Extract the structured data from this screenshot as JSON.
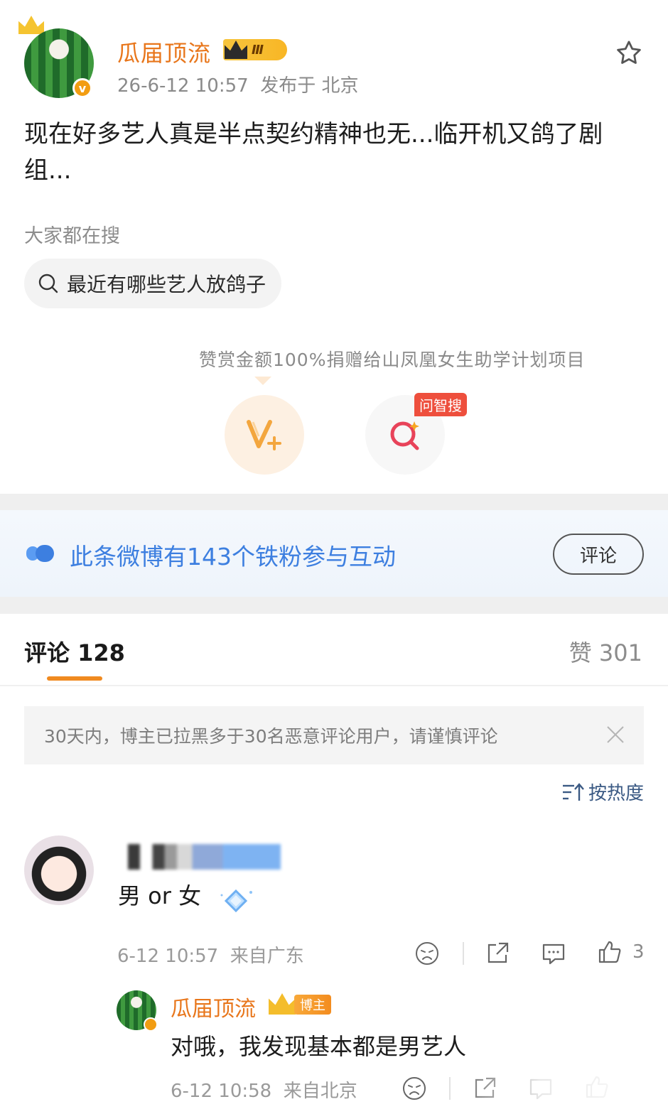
{
  "post": {
    "author": "瓜届顶流",
    "vip_level": "Ⅲ",
    "time": "26-6-12 10:57",
    "location": "发布于 北京",
    "body": "现在好多艺人真是半点契约精神也无...临开机又鸽了剧组..."
  },
  "search": {
    "label": "大家都在搜",
    "query": "最近有哪些艺人放鸽子"
  },
  "donate": {
    "text": "赞赏金额100%捐赠给山凤凰女生助学计划项目",
    "ask_tag": "问智搜"
  },
  "fans_banner": {
    "text": "此条微博有143个铁粉参与互动",
    "button": "评论"
  },
  "tabs": {
    "comments": "评论 128",
    "likes": "赞 301"
  },
  "notice": {
    "text": "30天内，博主已拉黑多于30名恶意评论用户，请谨慎评论"
  },
  "sort": {
    "label": "按热度"
  },
  "comments": [
    {
      "text": "男 or 女",
      "time": "6-12 10:57",
      "location": "来自广东",
      "likes": "3"
    }
  ],
  "reply": {
    "author": "瓜届顶流",
    "tag": "博主",
    "text": "对哦，我发现基本都是男艺人",
    "time": "6-12 10:58",
    "location": "来自北京"
  },
  "colors": {
    "brand_orange": "#e8761b",
    "fan_blue": "#3d7fe0",
    "tag_red": "#ee4f3d"
  }
}
